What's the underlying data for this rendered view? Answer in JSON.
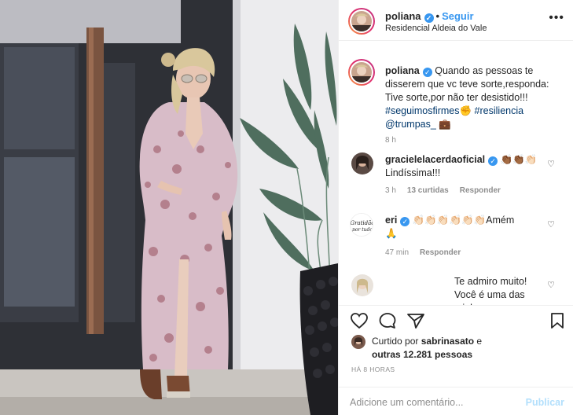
{
  "post": {
    "username": "poliana",
    "verified": true,
    "follow_label": "Seguir",
    "location": "Residencial Aldeia do Vale",
    "more_icon": "more-options-icon"
  },
  "caption": {
    "username": "poliana",
    "text": "Quando as pessoas te disserem que vc teve sorte,responda: Tive sorte,por não ter desistido!!!",
    "hashtags": [
      "#seguimosfirmes",
      "#resiliencia"
    ],
    "mention": "@trumpas_",
    "time": "8 h"
  },
  "comments": [
    {
      "username": "gracielelacerdaoficial",
      "text": "Lindíssima!!!",
      "time": "3 h",
      "likes": "13 curtidas",
      "reply": "Responder"
    },
    {
      "username": "eri",
      "text": "Amém",
      "time": "47 min",
      "reply": "Responder"
    },
    {
      "username": "",
      "text": "Te admiro muito! Você é uma das minhas",
      "time": "",
      "reply": ""
    }
  ],
  "actions": {
    "like_icon": "heart-icon",
    "comment_icon": "comment-icon",
    "share_icon": "share-icon",
    "save_icon": "bookmark-icon"
  },
  "likes": {
    "prefix": "Curtido por",
    "user": "sabrinasato",
    "connector": "e",
    "others": "outras 12.281 pessoas"
  },
  "timestamp": "HÁ 8 HORAS",
  "add_comment": {
    "placeholder": "Adicione um comentário...",
    "publish_label": "Publicar"
  },
  "colors": {
    "accent": "#3897f0",
    "link": "#00376b",
    "muted": "#8e8e8e",
    "publish_disabled": "#b2dffc"
  }
}
